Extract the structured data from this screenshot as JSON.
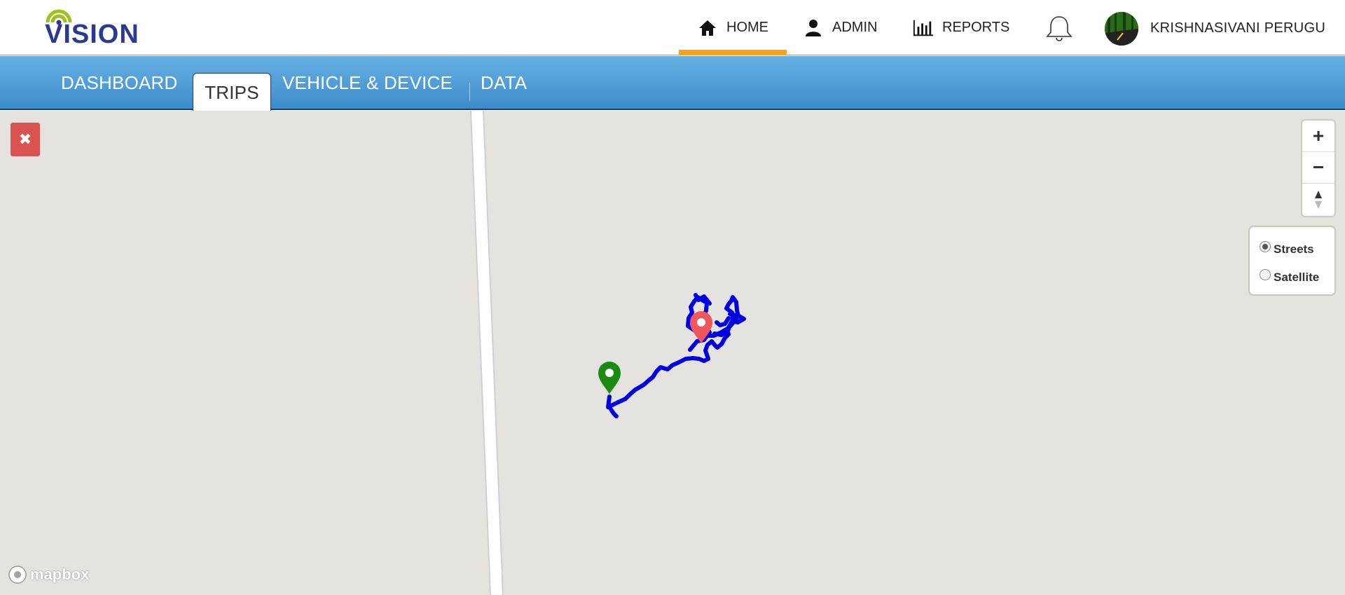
{
  "app": {
    "logo_text": "VISION",
    "user_name": "KRISHNASIVANI PERUGU"
  },
  "topnav": {
    "home": "HOME",
    "admin": "ADMIN",
    "reports": "REPORTS"
  },
  "subnav": {
    "tabs": [
      "DASHBOARD",
      "TRIPS",
      "VEHICLE & DEVICE",
      "DATA"
    ],
    "active_tab": "TRIPS"
  },
  "map": {
    "layers": [
      {
        "label": "Streets",
        "selected": true
      },
      {
        "label": "Satellite",
        "selected": false
      }
    ],
    "attribution": "mapbox",
    "route_color": "#0000e0",
    "start_marker_color": "#1a8a13",
    "end_marker_color": "#f0575a"
  },
  "colors": {
    "nav_active_underline": "#f5a21d",
    "subnav_top": "#66b1e3",
    "subnav_bottom": "#3f8ccc",
    "close_button": "#d9534f",
    "map_background": "#e4e3df"
  },
  "icons": {
    "home": "home-icon",
    "admin": "user-icon",
    "reports": "bar-chart-icon",
    "notifications": "bell-icon",
    "close": "close-icon",
    "zoom_in": "plus-icon",
    "zoom_out": "minus-icon",
    "compass": "compass-icon"
  }
}
